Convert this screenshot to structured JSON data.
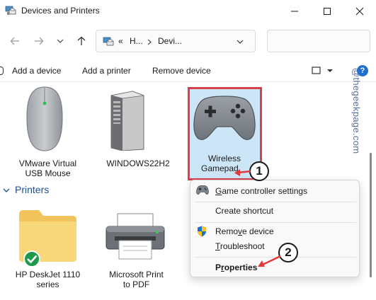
{
  "window": {
    "title": "Devices and Printers"
  },
  "address": {
    "sep1": "«",
    "seg1": "H...",
    "seg2": "Devi..."
  },
  "commands": {
    "add_device": "Add a device",
    "add_printer": "Add a printer",
    "remove_device": "Remove device"
  },
  "help_label": "?",
  "devices": [
    {
      "label_line1": "VMware Virtual",
      "label_line2": "USB Mouse",
      "icon": "mouse-icon"
    },
    {
      "label_line1": "WINDOWS22H2",
      "label_line2": "",
      "icon": "computer-tower-icon"
    },
    {
      "label_line1": "Wireless",
      "label_line2": "Gamepad",
      "icon": "gamepad-icon"
    }
  ],
  "printers_section": {
    "title": "Printers"
  },
  "printers": [
    {
      "label_line1": "HP DeskJet 1110",
      "label_line2": "series",
      "icon": "folder-printer-icon"
    },
    {
      "label_line1": "Microsoft Print",
      "label_line2": "to PDF",
      "icon": "printer-icon"
    }
  ],
  "context_menu": {
    "items": [
      {
        "label": "Game controller settings",
        "icon": "gamepad-small-icon",
        "mnemonic": "G"
      },
      {
        "label": "Create shortcut",
        "icon": "",
        "mnemonic": ""
      },
      {
        "label": "Remove device",
        "icon": "uac-shield-icon",
        "mnemonic": "v"
      },
      {
        "label": "Troubleshoot",
        "icon": "",
        "mnemonic": "T"
      },
      {
        "label": "Properties",
        "icon": "",
        "mnemonic": "r"
      }
    ]
  },
  "badges": [
    "1",
    "2"
  ],
  "watermark": "@thegeekpage.com",
  "colors": {
    "selection_fill": "#cde6f7",
    "highlight_border": "#d9414a",
    "section_title": "#1b4f9c",
    "help_blue": "#1f6fd1",
    "arrow_red": "#e23b3b"
  }
}
